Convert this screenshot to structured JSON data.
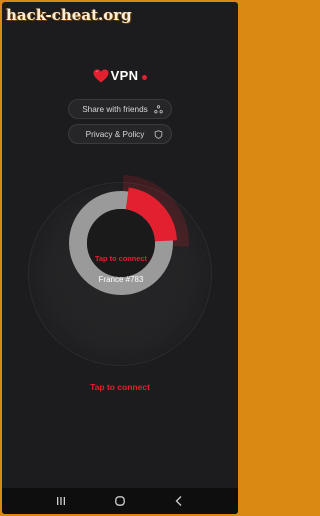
{
  "watermark": "hack-cheat.org",
  "logo": {
    "text": "VPN",
    "accent": "#e3202f"
  },
  "menu": {
    "share_label": "Share with friends",
    "share_icon": "share-icon",
    "privacy_label": "Privacy & Policy",
    "privacy_icon": "shield-icon"
  },
  "dial": {
    "status_text": "Tap to connect",
    "server_text": "France #783",
    "progress_fraction": 0.22
  },
  "connect_label": "Tap to connect",
  "navbar": {
    "icons": [
      "recent-apps-icon",
      "home-icon",
      "back-icon"
    ]
  },
  "colors": {
    "background": "#1c1c1e",
    "accent": "#e3202f",
    "ring": "#9a9a9a"
  }
}
